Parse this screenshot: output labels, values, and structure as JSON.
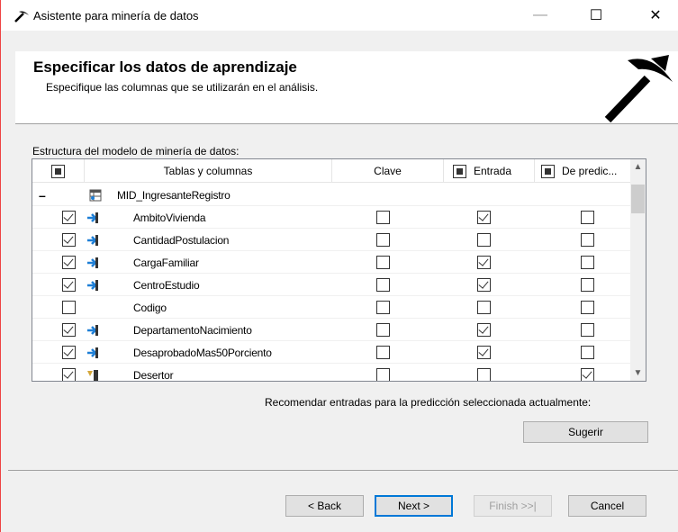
{
  "window": {
    "title": "Asistente para minería de datos",
    "minimize_glyph": "—",
    "maximize_glyph": "☐",
    "close_glyph": "✕"
  },
  "header": {
    "title": "Especificar los datos de aprendizaje",
    "subtitle": "Especifique las columnas que se utilizarán en el análisis."
  },
  "grid": {
    "label": "Estructura del modelo de minería de datos:",
    "columns": {
      "tables": "Tablas y columnas",
      "key": "Clave",
      "input": "Entrada",
      "predict": "De predic..."
    },
    "table_row": {
      "expander": "–",
      "name": "MID_IngresanteRegistro"
    },
    "rows": [
      {
        "name": "AmbitoVivienda",
        "include": true,
        "icon": "input-column-icon",
        "key": false,
        "input": true,
        "predict": false
      },
      {
        "name": "CantidadPostulacion",
        "include": true,
        "icon": "input-column-icon",
        "key": false,
        "input": false,
        "predict": false
      },
      {
        "name": "CargaFamiliar",
        "include": true,
        "icon": "input-column-icon",
        "key": false,
        "input": true,
        "predict": false
      },
      {
        "name": "CentroEstudio",
        "include": true,
        "icon": "input-column-icon",
        "key": false,
        "input": true,
        "predict": false
      },
      {
        "name": "Codigo",
        "include": false,
        "icon": "",
        "key": false,
        "input": false,
        "predict": false
      },
      {
        "name": "DepartamentoNacimiento",
        "include": true,
        "icon": "input-column-icon",
        "key": false,
        "input": true,
        "predict": false
      },
      {
        "name": "DesaprobadoMas50Porciento",
        "include": true,
        "icon": "input-column-icon",
        "key": false,
        "input": true,
        "predict": false
      },
      {
        "name": "Desertor",
        "include": true,
        "icon": "predict-column-icon",
        "key": false,
        "input": false,
        "predict": true
      }
    ]
  },
  "recommend": {
    "text": "Recomendar entradas para la predicción seleccionada actualmente:",
    "suggest_label": "Sugerir"
  },
  "footer": {
    "back_label": "< Back",
    "next_label": "Next >",
    "finish_label": "Finish >>|",
    "cancel_label": "Cancel"
  },
  "colors": {
    "accent": "#0078d7",
    "input_icon": "#1e7fd6",
    "predict_icon": "#d4a63a"
  }
}
